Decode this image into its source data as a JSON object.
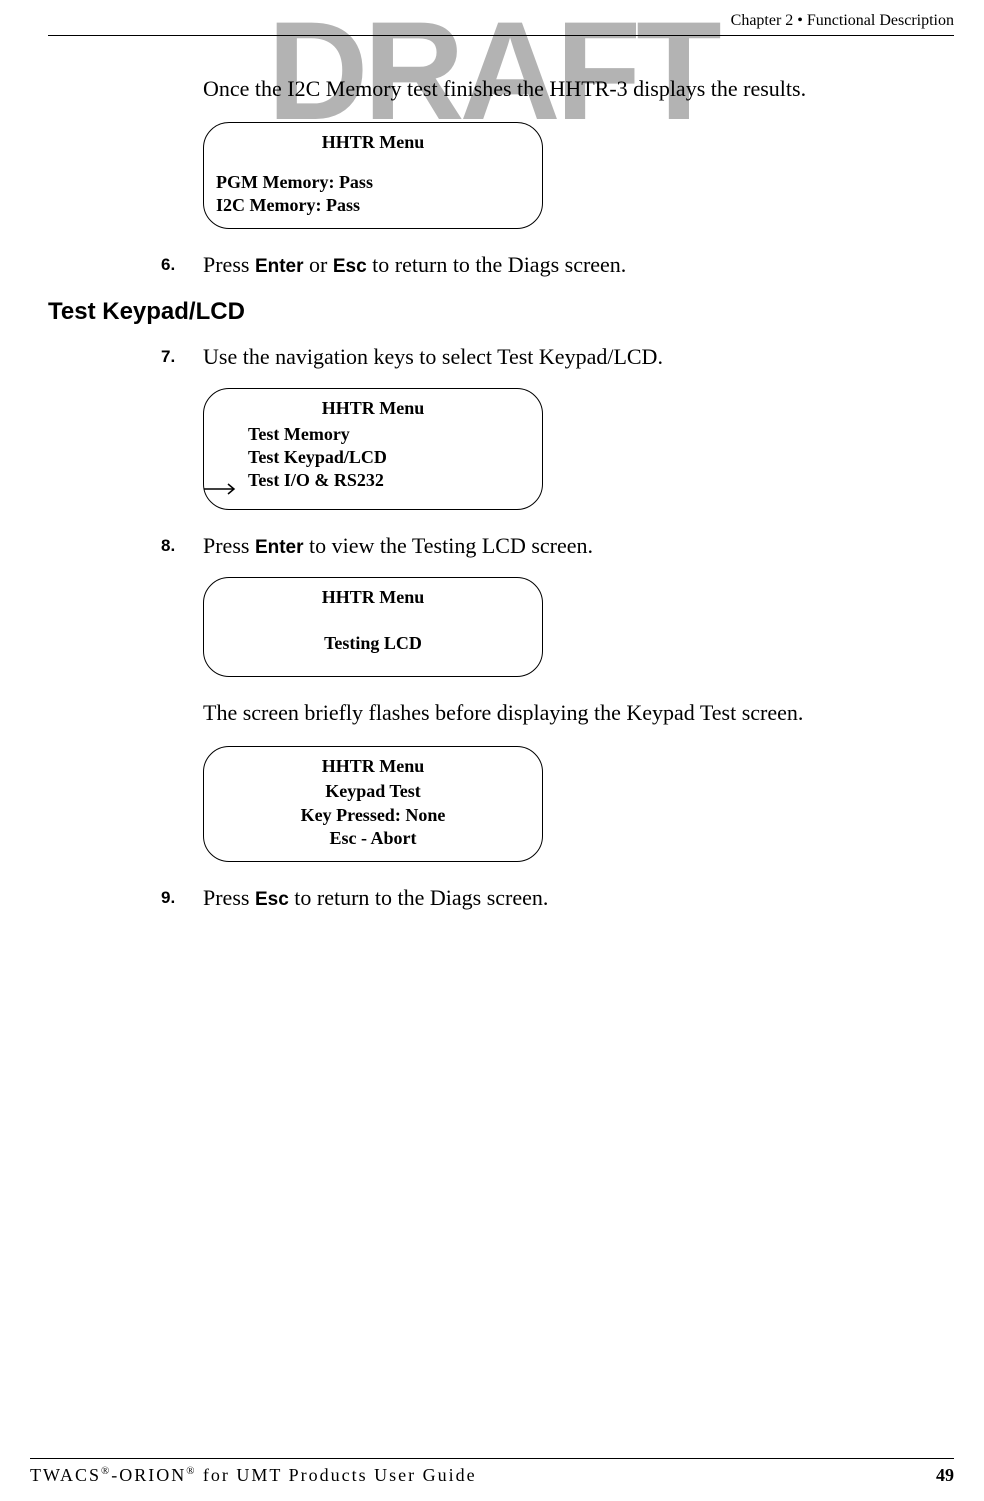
{
  "watermark": "DRAFT",
  "header": "Chapter 2 • Functional Description",
  "intro": "Once the I2C Memory test finishes the HHTR-3 displays the results.",
  "lcd1": {
    "title": "HHTR Menu",
    "line1": "PGM Memory:  Pass",
    "line2": "I2C Memory:  Pass"
  },
  "step6": {
    "num": "6.",
    "pre": "Press ",
    "k1": "Enter",
    "mid": " or ",
    "k2": "Esc",
    "post": " to return to the Diags screen."
  },
  "section": "Test Keypad/LCD",
  "step7": {
    "num": "7.",
    "text": "Use the navigation keys to select Test Keypad/LCD."
  },
  "lcd2": {
    "title": "HHTR Menu",
    "item1": "Test Memory",
    "item2": "Test Keypad/LCD",
    "item3": "Test I/O & RS232"
  },
  "step8": {
    "num": "8.",
    "pre": "Press ",
    "k1": "Enter",
    "post": " to view the Testing LCD screen."
  },
  "lcd3": {
    "title": "HHTR Menu",
    "line1": "Testing LCD"
  },
  "mid_para": "The screen briefly flashes before displaying the Keypad Test screen.",
  "lcd4": {
    "title": "HHTR Menu",
    "line1": "Keypad Test",
    "line2": "Key Pressed:  None",
    "line3": "Esc - Abort"
  },
  "step9": {
    "num": "9.",
    "pre": "Press ",
    "k1": "Esc",
    "post": " to return to the Diags screen."
  },
  "footer_left_1": "TWACS",
  "footer_left_2": "-ORION",
  "footer_left_3": " for UMT Products User Guide",
  "footer_right": "49"
}
